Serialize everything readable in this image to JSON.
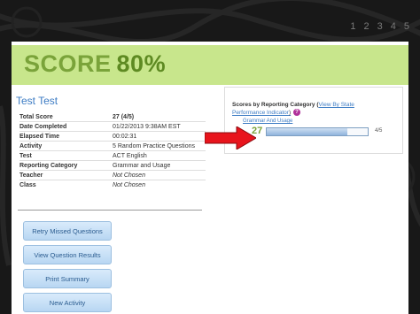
{
  "pager": {
    "pages": [
      "1",
      "2",
      "3",
      "4",
      "5"
    ]
  },
  "score": {
    "label": "SCORE",
    "value": "80%"
  },
  "student": {
    "name": "Test Test"
  },
  "details": [
    {
      "key": "Total Score",
      "value": "27 (4/5)",
      "bold": true
    },
    {
      "key": "Date Completed",
      "value": "01/22/2013 9:38AM EST"
    },
    {
      "key": "Elapsed Time",
      "value": "00:02:31"
    },
    {
      "key": "Activity",
      "value": "5 Random Practice Questions"
    },
    {
      "key": "Test",
      "value": "ACT English"
    },
    {
      "key": "Reporting Category",
      "value": "Grammar and Usage"
    },
    {
      "key": "Teacher",
      "value": "Not Chosen",
      "italic": true
    },
    {
      "key": "Class",
      "value": "Not Chosen",
      "italic": true
    }
  ],
  "buttons": {
    "retry": "Retry Missed Questions",
    "view": "View Question Results",
    "print": "Print Summary",
    "new_activity": "New Activity"
  },
  "panel": {
    "title": "Scores by Reporting Category",
    "link_open": "(",
    "link_text": "View By State",
    "link_text2": "Performance Indicator",
    "link_close": ")",
    "info_icon": "?",
    "category": "Grammar And Usage",
    "score": "27",
    "fraction": "4/5",
    "progress": 0.8
  },
  "colors": {
    "score_bg": "#c8e68c",
    "score_text": "#7aa33a",
    "arrow": "#e8141c",
    "link": "#3d7cc4"
  }
}
